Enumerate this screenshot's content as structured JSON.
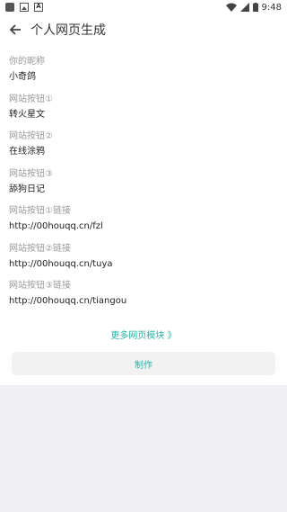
{
  "status_bar": {
    "time": "9:48",
    "icons": [
      "square-icon",
      "image-icon",
      "a-icon",
      "wifi-icon",
      "signal-icon",
      "battery-icon"
    ]
  },
  "header": {
    "title": "个人网页生成",
    "back_icon": "arrow-left-icon"
  },
  "fields": [
    {
      "label": "你的昵称",
      "value": "小奇鸽"
    },
    {
      "label": "网站按钮①",
      "value": "转火星文"
    },
    {
      "label": "网站按钮②",
      "value": "在线涂鸦"
    },
    {
      "label": "网站按钮③",
      "value": "舔狗日记"
    },
    {
      "label": "网站按钮①链接",
      "value": "http://00houqq.cn/fzl"
    },
    {
      "label": "网站按钮②链接",
      "value": "http://00houqq.cn/tuya"
    },
    {
      "label": "网站按钮③链接",
      "value": "http://00houqq.cn/tiangou"
    }
  ],
  "more_link": "更多网页模块 》",
  "make_button": "制作",
  "colors": {
    "accent": "#26b5a6",
    "label": "#999999",
    "value": "#222222",
    "background": "#f0eff4"
  }
}
